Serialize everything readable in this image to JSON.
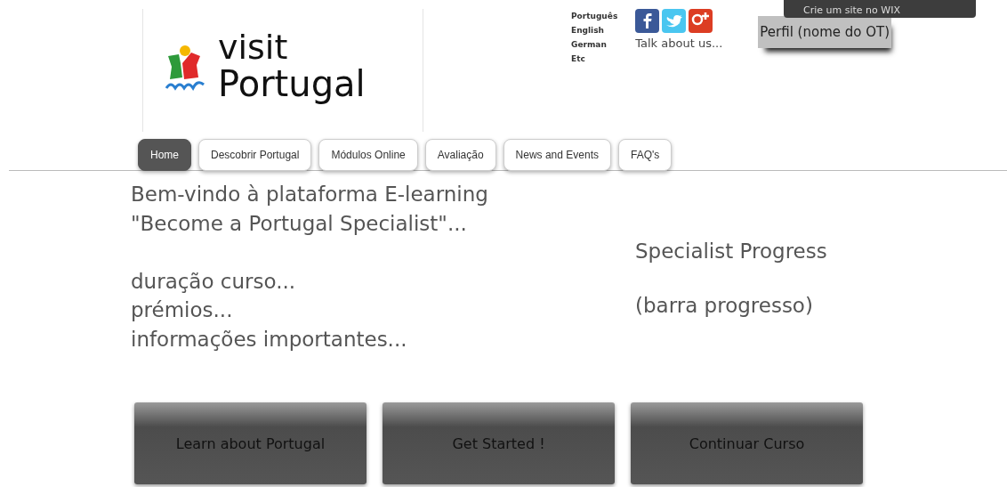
{
  "banner": {
    "text": "Crie um site no WIX"
  },
  "logo": {
    "line1": "visit",
    "line2": "Portugal"
  },
  "languages": [
    "Português",
    "English",
    "German",
    "Etc"
  ],
  "social": {
    "caption": "Talk about us..."
  },
  "profile_button": "Perfil (nome do OT)",
  "nav": [
    {
      "label": "Home",
      "selected": true
    },
    {
      "label": "Descobrir Portugal",
      "selected": false
    },
    {
      "label": "Módulos Online",
      "selected": false
    },
    {
      "label": "Avaliação",
      "selected": false
    },
    {
      "label": "News and Events",
      "selected": false
    },
    {
      "label": "FAQ's",
      "selected": false
    }
  ],
  "intro": [
    [
      "Bem-vindo à plataforma E-learning",
      "\"Become a Portugal Specialist\"..."
    ],
    [
      "duração curso...",
      "prémios...",
      "informações importantes..."
    ]
  ],
  "progress": {
    "title": "Specialist Progress",
    "bar_text": "(barra progresso)"
  },
  "actions": [
    "Learn about Portugal",
    "Get Started !",
    "Continuar Curso"
  ]
}
